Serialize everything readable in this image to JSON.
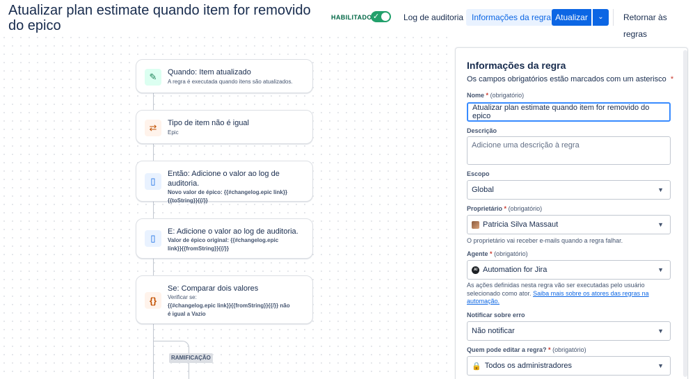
{
  "header": {
    "title": "Atualizar plan estimate quando item for removido do epico",
    "enabled_label": "HABILITADO",
    "audit_log_label": "Log de auditoria",
    "rule_info_label": "Informações da regra",
    "update_label": "Atualizar",
    "return_label": "Retornar às regras"
  },
  "flow": {
    "trigger": {
      "title": "Quando: Item atualizado",
      "desc": "A regra é executada quando itens são atualizados."
    },
    "condition": {
      "title": "Tipo de item não é igual",
      "desc": "Epic"
    },
    "action1": {
      "title": "Então: Adicione o valor ao log de auditoria.",
      "line1": "Novo valor de épico: {{#changelog.epic link}}",
      "line2": "{{toString}}{{/}}"
    },
    "action2": {
      "title": "E: Adicione o valor ao log de auditoria.",
      "line1": "Valor de épico original: {{#changelog.epic",
      "line2": "link}}{{fromString}}{{/}}"
    },
    "compare": {
      "title": "Se: Comparar dois valores",
      "desc": "Verificar se:",
      "line1": "{{#changelog.epic link}}{{fromString}}{{/}} não",
      "line2": "é igual a Vazio"
    },
    "branch_label": "RAMIFICAÇÃO"
  },
  "panel": {
    "title": "Informações da regra",
    "subtitle": "Os campos obrigatórios estão marcados com um asterisco",
    "asterisk": "*",
    "required_suffix": "(obrigatório)",
    "name_label": "Nome",
    "name_value": "Atualizar plan estimate quando item for removido do epico",
    "description_label": "Descrição",
    "description_placeholder": "Adicione uma descrição à regra",
    "scope_label": "Escopo",
    "scope_value": "Global",
    "owner_label": "Proprietário",
    "owner_value": "Patricia Silva Massaut",
    "owner_helper": "O proprietário vai receber e-mails quando a regra falhar.",
    "actor_label": "Agente",
    "actor_value": "Automation for Jira",
    "actor_helper": "As ações definidas nesta regra vão ser executadas pelo usuário selecionado como ator.",
    "actor_link": "Saiba mais sobre os atores das regras na automação.",
    "notify_label": "Notificar sobre erro",
    "notify_value": "Não notificar",
    "editors_label": "Quem pode editar a regra?",
    "editors_value": "Todos os administradores"
  },
  "colors": {
    "accent": "#0c66e4",
    "enabled": "#22a06b"
  },
  "icons": {
    "trigger": "pencil-icon",
    "condition": "shuffle-icon",
    "action": "document-icon",
    "compare": "braces-icon",
    "chevron": "chevron-down-icon",
    "check": "check-icon",
    "lock": "lock-icon"
  }
}
